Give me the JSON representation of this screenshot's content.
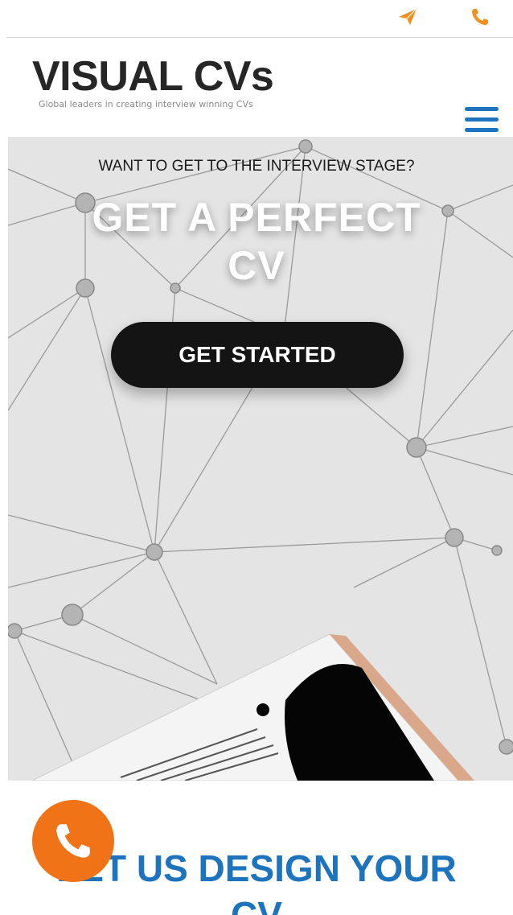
{
  "topbar": {
    "send_icon": "paper-plane-icon",
    "phone_icon": "phone-icon",
    "accent": "#f0901e"
  },
  "header": {
    "logo": "VISUAL CVs",
    "tagline": "Global leaders in creating interview winning CVs",
    "menu_icon": "hamburger-menu-icon",
    "menu_color": "#1e73be"
  },
  "hero": {
    "eyebrow": "WANT TO GET TO THE INTERVIEW STAGE?",
    "headline_line1": "GET A PERFECT",
    "headline_line2": "CV",
    "cta_label": "GET STARTED"
  },
  "section": {
    "title_line1": "LET US DESIGN YOUR",
    "title_line2": "CV"
  },
  "fab": {
    "icon": "phone-icon",
    "color": "#f07318"
  }
}
